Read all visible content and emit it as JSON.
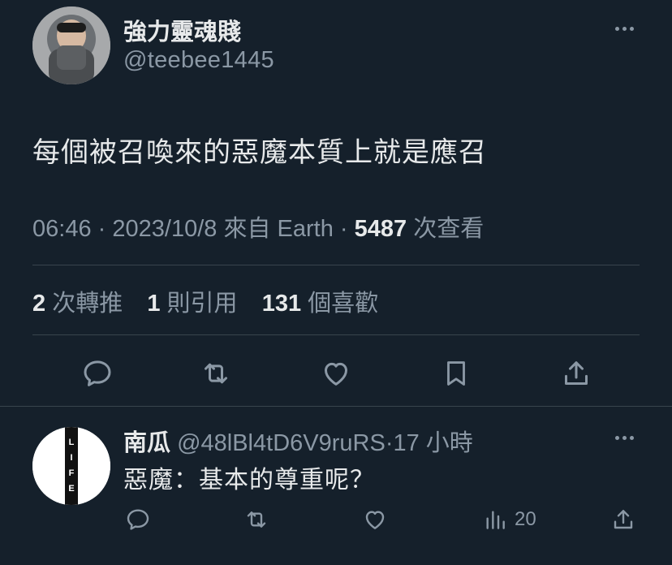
{
  "tweet": {
    "author": {
      "name": "強力靈魂賤",
      "handle": "@teebee1445",
      "avatar": "avatar-photo"
    },
    "text": "每個被召喚來的惡魔本質上就是應召",
    "time": "06:46",
    "sep1": "·",
    "date": "2023/10/8",
    "source": "來自 Earth",
    "sep2": "·",
    "views": "5487",
    "views_label": "次查看",
    "stats": {
      "retweets": "2",
      "retweets_label": "次轉推",
      "quotes": "1",
      "quotes_label": "則引用",
      "likes": "131",
      "likes_label": "個喜歡"
    },
    "actions": [
      "reply-icon",
      "retweet-icon",
      "like-icon",
      "bookmark-icon",
      "share-icon"
    ]
  },
  "reply": {
    "name": "南瓜",
    "handle": "@48lBl4tD6V9ruRS",
    "sep": "·",
    "time": "17 小時",
    "text": "惡魔：基本的尊重呢？",
    "avatar_letters": [
      "L",
      "I",
      "F",
      "E"
    ],
    "views": "20",
    "actions": [
      "reply-icon",
      "retweet-icon",
      "like-icon",
      "views-icon",
      "share-icon"
    ]
  },
  "colors": {
    "background": "#15202b",
    "text": "#e7e9ea",
    "muted": "#8b98a5",
    "divider": "#38444d"
  }
}
